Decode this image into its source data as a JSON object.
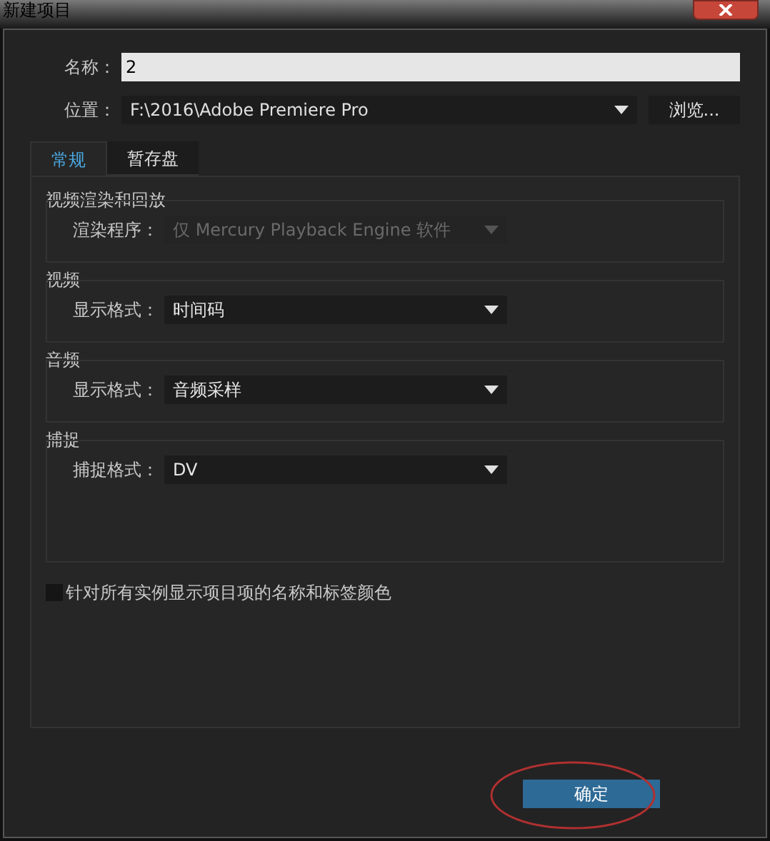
{
  "window": {
    "title": "新建项目"
  },
  "name_field": {
    "label": "名称：",
    "value": "2"
  },
  "location": {
    "label": "位置：",
    "value": "F:\\2016\\Adobe Premiere Pro",
    "browse_button": "浏览..."
  },
  "tabs": [
    {
      "label": "常规",
      "selected": true
    },
    {
      "label": "暂存盘",
      "selected": false
    }
  ],
  "groups": [
    {
      "title": "视频渲染和回放",
      "rows": [
        {
          "label": "渲染程序：",
          "value": "仅 Mercury Playback Engine 软件",
          "disabled": true
        }
      ]
    },
    {
      "title": "视频",
      "rows": [
        {
          "label": "显示格式：",
          "value": "时间码",
          "disabled": false
        }
      ]
    },
    {
      "title": "音频",
      "rows": [
        {
          "label": "显示格式：",
          "value": "音频采样",
          "disabled": false
        }
      ]
    },
    {
      "title": "捕捉",
      "rows": [
        {
          "label": "捕捉格式：",
          "value": "DV",
          "disabled": false
        }
      ]
    }
  ],
  "checkbox": {
    "label": "针对所有实例显示项目项的名称和标签颜色",
    "checked": false
  },
  "buttons": [
    {
      "label": "确定",
      "primary": true
    }
  ]
}
